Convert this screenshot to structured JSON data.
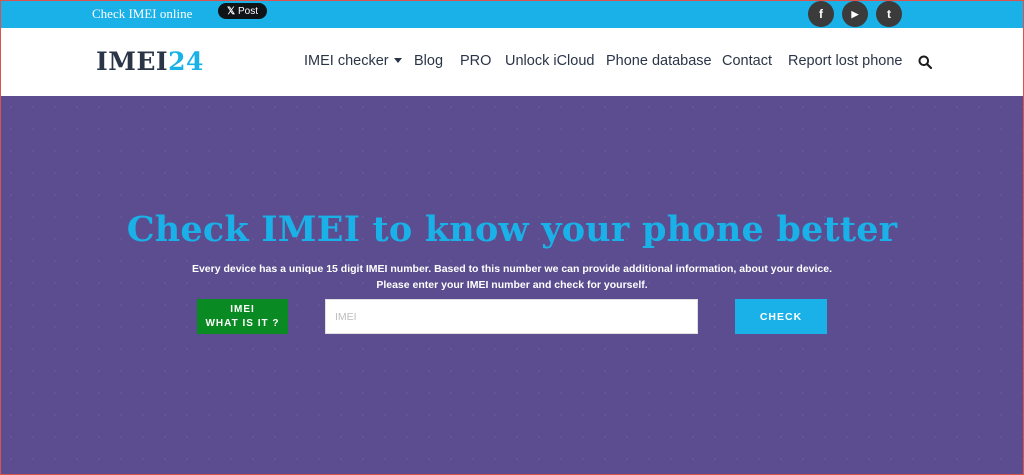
{
  "topbar": {
    "text": "Check IMEI online",
    "x_button": {
      "icon": "x-logo-icon",
      "label": "Post"
    },
    "social": [
      {
        "name": "facebook",
        "icon": "facebook-icon",
        "glyph": "f"
      },
      {
        "name": "youtube",
        "icon": "youtube-icon",
        "glyph": "▶"
      },
      {
        "name": "twitter",
        "icon": "twitter-icon",
        "glyph": "t"
      }
    ]
  },
  "nav": {
    "logo_part1": "IMEI",
    "logo_part2": "24",
    "items": [
      {
        "label": "IMEI checker",
        "dropdown": true
      },
      {
        "label": "Blog"
      },
      {
        "label": "PRO"
      },
      {
        "label": "Unlock iCloud"
      },
      {
        "label": "Phone database"
      },
      {
        "label": "Contact"
      },
      {
        "label": "Report lost phone"
      }
    ],
    "search_icon": "search-icon"
  },
  "hero": {
    "headline": "Check IMEI to know your phone better",
    "sub_line1": "Every device has a unique 15 digit IMEI number. Based to this number we can provide additional information, about your device.",
    "sub_line2": "Please enter your IMEI number and check for yourself.",
    "imei_button_line1": "IMEI",
    "imei_button_line2": "WHAT IS IT ?",
    "input_placeholder": "IMEI",
    "input_value": "",
    "check_label": "CHECK"
  },
  "colors": {
    "accent": "#1ab1e8",
    "hero_bg": "#5b4d8f",
    "nav_text": "#2a3548",
    "green_button": "#0a8a22"
  }
}
